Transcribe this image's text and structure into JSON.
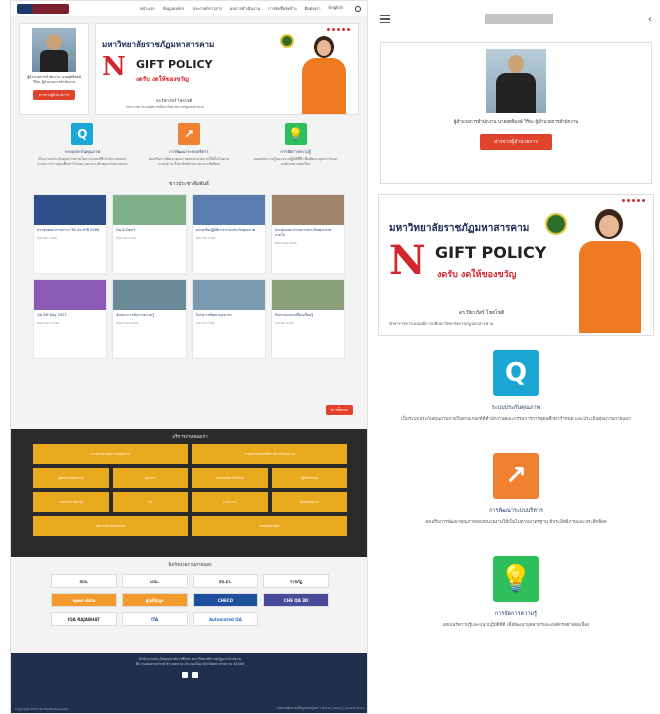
{
  "desktop": {
    "nav": {
      "links": [
        "หน้าแรก",
        "ข้อมูลองค์กร",
        "ประกาศ/ข่าวสาร",
        "ผลการดำเนินงาน",
        "การจัดซื้อจัดจ้าง",
        "ติดต่อเรา",
        "English"
      ]
    },
    "exec": {
      "caption": "ผู้อำนวยการสำนักงาน นายสุทธิพงษ์ วิริยะ ผู้อำนวยการสำนักงาน",
      "button": "สารจากผู้อำนวยการ"
    },
    "banner": {
      "heading": "มหาวิทยาลัยราชภัฏมหาสารคาม",
      "no": "N",
      "gift": "GIFT POLICY",
      "sub": "งดรับ งดให้ของขวัญ",
      "signer": "ดร.ปิยาภัสร์ ไชยโชติ",
      "signer_title": "รักษาราชการแทนอธิการบดีมหาวิทยาลัยราชภัฏมหาสารคาม"
    },
    "features": [
      {
        "icon": "Q",
        "color": "#1aa7d6",
        "title": "ระบบประกันคุณภาพ",
        "text": "เป็นระบบประกันคุณภาพภายในตามเกณฑ์ที่ สำนักงานคณะกรรมการการอุดมศึกษากำหนด และประเมินคุณภาพภายนอก"
      },
      {
        "icon": "↗",
        "color": "#f08130",
        "title": "การพัฒนาระบบบริหาร",
        "text": "ส่งเสริมการพัฒนาคุณภาพของหน่วยงานให้เป็นไปตามมาตรฐาน มีประสิทธิภาพ และประสิทธิผล"
      },
      {
        "icon": "💡",
        "color": "#2fbf5a",
        "title": "การจัดการความรู้",
        "text": "เผยแพร่ความรู้และแนวปฏิบัติที่ดี เพื่อพัฒนาบุคลากรและองค์กรอย่างต่อเนื่อง"
      }
    ],
    "news_heading": "ข่าวประชาสัมพันธ์",
    "news": [
      {
        "title": "ประชุมคณะกรรมการ ITA ประจำปี 2566",
        "date": "มิถุนายน 2566",
        "color": "#2f4f8a"
      },
      {
        "title": "Do & Don't",
        "date": "มิถุนายน 2566",
        "color": "#7fb08a"
      },
      {
        "title": "อบรมเชิงปฏิบัติการระบบประกันคุณภาพ",
        "date": "มิถุนายน 2566",
        "color": "#5a7db0"
      },
      {
        "title": "ประชุมคณะกรรมการประเมินคุณภาพภายใน",
        "date": "พฤษภาคม 2566",
        "color": "#a0846a"
      },
      {
        "title": "QA KM Day 2023",
        "date": "พฤษภาคม 2566",
        "color": "#8a5ab4"
      },
      {
        "title": "สัมมนาการจัดการความรู้",
        "date": "พฤษภาคม 2566",
        "color": "#6a8a9a"
      },
      {
        "title": "โครงการพัฒนาบุคลากร",
        "date": "เมษายน 2566",
        "color": "#7a9ab0"
      },
      {
        "title": "กิจกรรมแลกเปลี่ยนเรียนรู้",
        "date": "เมษายน 2566",
        "color": "#8aa07a"
      }
    ],
    "more_button": "ข่าวทั้งหมด",
    "services_heading": "บริการงานของเรา",
    "services": [
      {
        "label": "ระบบรายงานผลการดำเนินงาน",
        "wide": true
      },
      {
        "label": "ระบบสารสนเทศเพื่อการประกันคุณภาพ",
        "wide": true
      },
      {
        "label": "คู่มือประกันคุณภาพ",
        "wide": false
      },
      {
        "label": "บุคลากร",
        "wide": false
      },
      {
        "label": "แบบฟอร์มดาวน์โหลด",
        "wide": false
      },
      {
        "label": "ปฏิทินกิจกรรม",
        "wide": false
      },
      {
        "label": "รายงานการประชุม",
        "wide": false
      },
      {
        "label": "ITA",
        "wide": false
      },
      {
        "label": "e-Service",
        "wide": false
      },
      {
        "label": "ติดต่อสอบถาม",
        "wide": false
      },
      {
        "label": "ผลการประเมินคุณภาพ",
        "wide": true
      },
      {
        "label": "แผนยุทธศาสตร์",
        "wide": true
      }
    ],
    "links_heading": "ลิงก์หน่วยงานภายนอก",
    "links": [
      "สกอ.",
      "มรม.",
      "สป.อว.",
      "ราชภัฏ",
      "open data",
      "ศูนย์ข้อมูล",
      "CHECO",
      "CHE QA 3D",
      "IQA RAJABHAT",
      "ITA",
      "Automated QA"
    ],
    "footer": {
      "line1": "สำนักงานประกันคุณภาพการศึกษา มหาวิทยาลัยราชภัฏมหาสารคาม",
      "line2": "80 ถนนนครสวรรค์ ตำบลตลาด อำเภอเมือง จังหวัดมหาสารคาม 44000",
      "copy": "Copyright 2023 All Rights Reserved",
      "policy": "นโยบายคุ้มครองข้อมูลส่วนบุคคล | Privacy Policy | Cookie Policy"
    }
  },
  "mobile": {
    "exec": {
      "caption": "ผู้อำนวยการสำนักงาน นายสุทธิพงษ์ วิริยะ ผู้อำนวยการสำนักงาน",
      "button": "สารจากผู้อำนวยการ"
    },
    "banner": {
      "heading": "มหาวิทยาลัยราชภัฏมหาสารคาม",
      "no": "N",
      "gift": "GIFT POLICY",
      "sub": "งดรับ งดให้ของขวัญ",
      "signer": "ดร.ปิยาภัสร์ ไชยโชติ",
      "signer_title": "รักษาราชการแทนอธิการบดีมหาวิทยาลัยราชภัฏมหาสารคาม"
    },
    "features": [
      {
        "icon": "Q",
        "color": "#1aa7d6",
        "title": "ระบบประกันคุณภาพ",
        "text": "เป็นระบบประกันคุณภาพภายในตามเกณฑ์ที่สำนักงานคณะกรรมการการอุดมศึกษากำหนด และประเมินคุณภาพภายนอก"
      },
      {
        "icon": "↗",
        "color": "#f08130",
        "title": "การพัฒนาระบบบริหาร",
        "text": "ส่งเสริมการพัฒนาคุณภาพของหน่วยงานให้เป็นไปตามมาตรฐาน มีประสิทธิภาพและประสิทธิผล"
      },
      {
        "icon": "💡",
        "color": "#2fbf5a",
        "title": "การจัดการความรู้",
        "text": "เผยแพร่ความรู้และแนวปฏิบัติที่ดี เพื่อพัฒนาบุคลากรและองค์กรอย่างต่อเนื่อง"
      }
    ]
  }
}
